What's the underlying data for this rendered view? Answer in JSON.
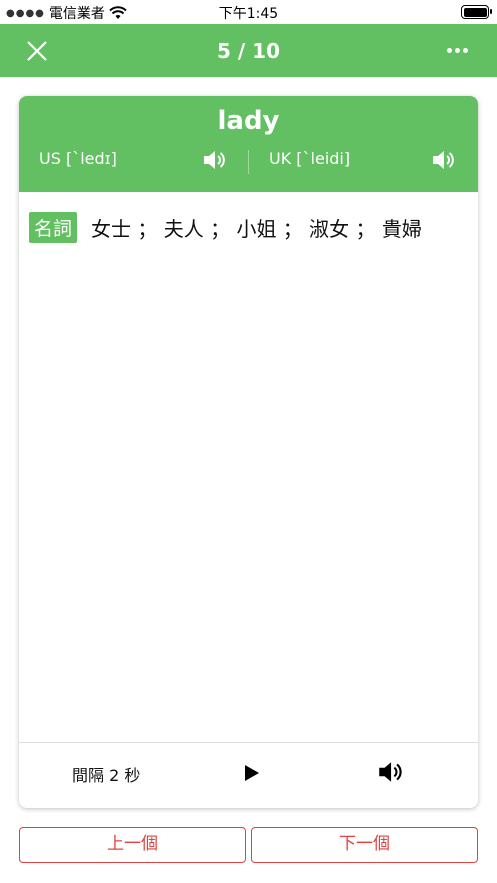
{
  "status_bar": {
    "carrier": "電信業者",
    "time": "下午1:45"
  },
  "header": {
    "progress": "5 / 10"
  },
  "card": {
    "word": "lady",
    "us_pron": "US [ˋledɪ]",
    "uk_pron": "UK [ˋleidi]",
    "part_of_speech": "名詞",
    "meaning": "女士 ； 夫人 ； 小姐 ； 淑女 ； 貴婦"
  },
  "controls": {
    "interval_label": "間隔 2 秒"
  },
  "buttons": {
    "prev_label": "上一個",
    "next_label": "下一個"
  },
  "colors": {
    "primary_green": "#62c062",
    "accent_red": "#e04343"
  },
  "icons": [
    "wifi-icon",
    "battery-icon",
    "close-icon",
    "more-icon",
    "speaker-icon",
    "play-icon"
  ]
}
